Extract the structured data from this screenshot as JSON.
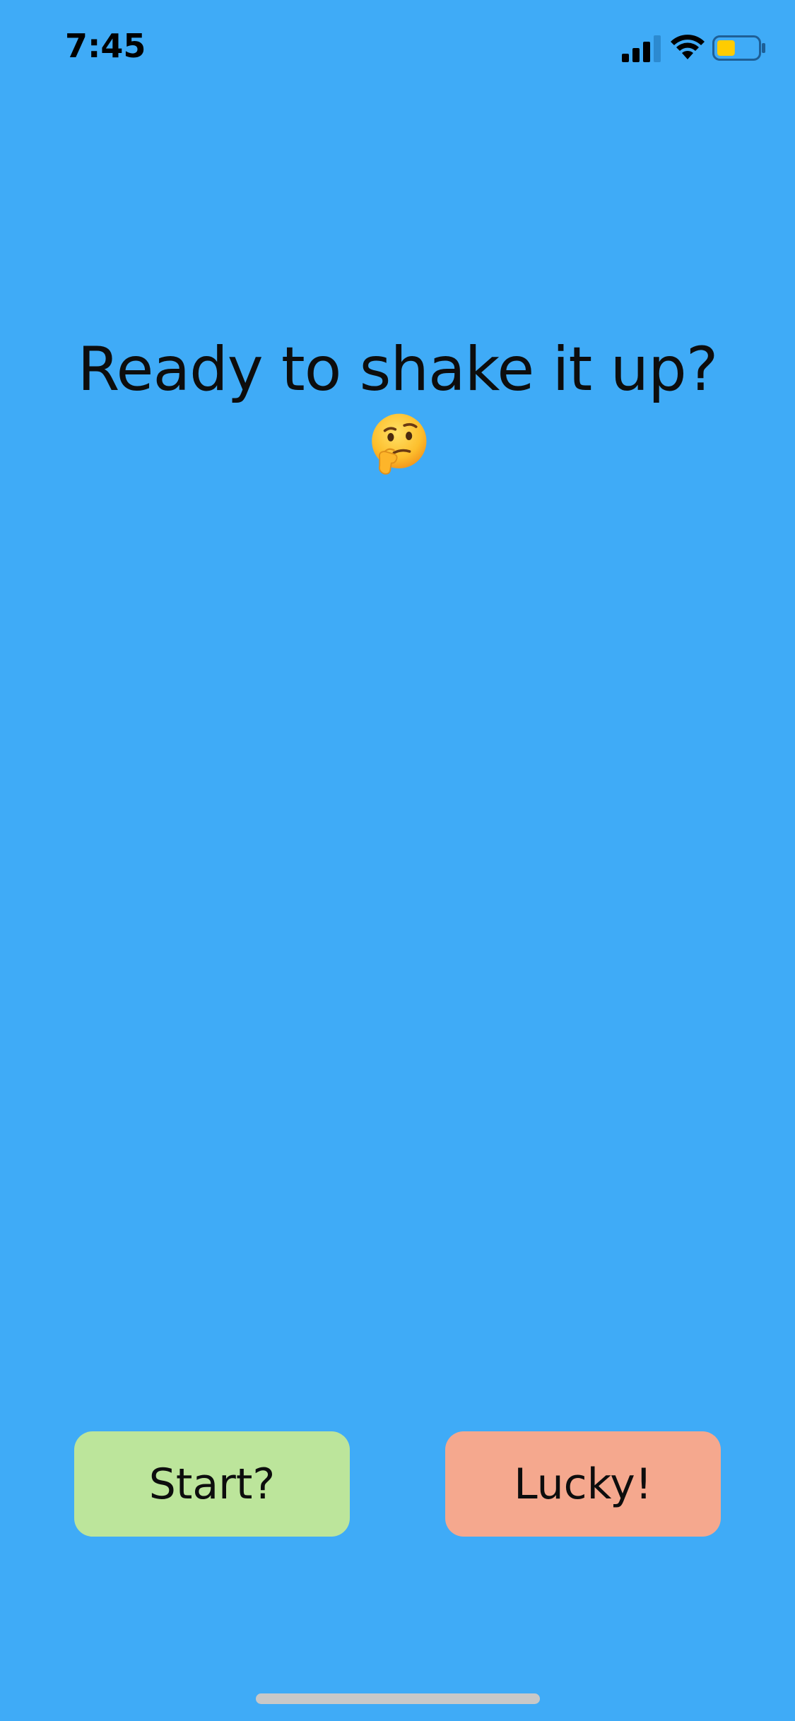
{
  "status_bar": {
    "time": "7:45",
    "icons": [
      "cellular-signal-icon",
      "wifi-icon",
      "battery-icon"
    ],
    "battery_level": 0.45,
    "battery_color": "#FFCC00"
  },
  "prompt": {
    "text": "Ready to shake it up?",
    "emoji": "thinking-face-icon"
  },
  "buttons": {
    "start_label": "Start?",
    "lucky_label": "Lucky!"
  },
  "colors": {
    "background": "#3FABF7",
    "start_button": "#BCE59B",
    "lucky_button": "#F5A88E",
    "text": "#0d0d0d"
  }
}
